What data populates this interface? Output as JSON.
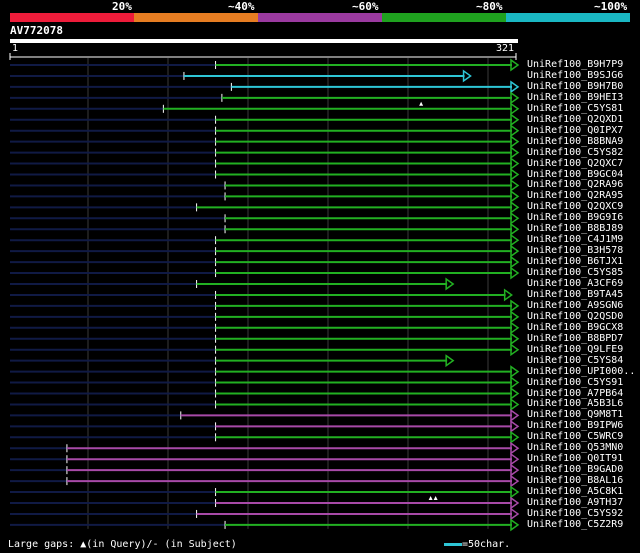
{
  "scale": {
    "labels": [
      "20%",
      "~40%",
      "~60%",
      "~80%",
      "~100%"
    ],
    "colors": [
      "#ee1c3a",
      "#e67d22",
      "#9b3aa0",
      "#1fa21f",
      "#1ab7c3"
    ]
  },
  "query": {
    "id": "AV772078",
    "start": "1",
    "end": "321",
    "length": 321
  },
  "colors": {
    "green": "#22b022",
    "cyan": "#2ec6d6",
    "purple": "#a84aa8",
    "navy": "#101a45",
    "grid": "#3a3a3a"
  },
  "hits": [
    {
      "label": "UniRef100_B9H7P9",
      "start": 131,
      "end": 321,
      "color": "green",
      "arrow": true
    },
    {
      "label": "UniRef100_B9SJG6",
      "start": 111,
      "end": 291,
      "color": "cyan",
      "arrow": true
    },
    {
      "label": "UniRef100_B9H7B0",
      "start": 141,
      "end": 321,
      "color": "cyan",
      "arrow": true
    },
    {
      "label": "UniRef100_B9HEI3",
      "start": 135,
      "end": 321,
      "color": "green",
      "arrow": true
    },
    {
      "label": "UniRef100_C5YS81",
      "start": 98,
      "end": 321,
      "color": "green",
      "arrow": true,
      "gap": 261
    },
    {
      "label": "UniRef100_Q2QXD1",
      "start": 131,
      "end": 321,
      "color": "green",
      "arrow": true
    },
    {
      "label": "UniRef100_Q0IPX7",
      "start": 131,
      "end": 321,
      "color": "green",
      "arrow": true
    },
    {
      "label": "UniRef100_B8BNA9",
      "start": 131,
      "end": 321,
      "color": "green",
      "arrow": true
    },
    {
      "label": "UniRef100_C5YS82",
      "start": 131,
      "end": 321,
      "color": "green",
      "arrow": true
    },
    {
      "label": "UniRef100_Q2QXC7",
      "start": 131,
      "end": 321,
      "color": "green",
      "arrow": true
    },
    {
      "label": "UniRef100_B9GC04",
      "start": 131,
      "end": 321,
      "color": "green",
      "arrow": true
    },
    {
      "label": "UniRef100_Q2RA96",
      "start": 137,
      "end": 321,
      "color": "green",
      "arrow": true
    },
    {
      "label": "UniRef100_Q2RA95",
      "start": 137,
      "end": 321,
      "color": "green",
      "arrow": true
    },
    {
      "label": "UniRef100_Q2QXC9",
      "start": 119,
      "end": 321,
      "color": "green",
      "arrow": true
    },
    {
      "label": "UniRef100_B9G9I6",
      "start": 137,
      "end": 321,
      "color": "green",
      "arrow": true
    },
    {
      "label": "UniRef100_B8BJ89",
      "start": 137,
      "end": 321,
      "color": "green",
      "arrow": true
    },
    {
      "label": "UniRef100_C4J1M9",
      "start": 131,
      "end": 321,
      "color": "green",
      "arrow": true
    },
    {
      "label": "UniRef100_B3H578",
      "start": 131,
      "end": 321,
      "color": "green",
      "arrow": true
    },
    {
      "label": "UniRef100_B6TJX1",
      "start": 131,
      "end": 321,
      "color": "green",
      "arrow": true
    },
    {
      "label": "UniRef100_C5YS85",
      "start": 131,
      "end": 321,
      "color": "green",
      "arrow": true
    },
    {
      "label": "UniRef100_A3CF69",
      "start": 119,
      "end": 280,
      "color": "green",
      "arrow": true
    },
    {
      "label": "UniRef100_B9TA45",
      "start": 131,
      "end": 317,
      "color": "green",
      "arrow": true
    },
    {
      "label": "UniRef100_A9SGN6",
      "start": 131,
      "end": 321,
      "color": "green",
      "arrow": true
    },
    {
      "label": "UniRef100_Q2QSD0",
      "start": 131,
      "end": 321,
      "color": "green",
      "arrow": true
    },
    {
      "label": "UniRef100_B9GCX8",
      "start": 131,
      "end": 321,
      "color": "green",
      "arrow": true
    },
    {
      "label": "UniRef100_B8BPD7",
      "start": 131,
      "end": 321,
      "color": "green",
      "arrow": true
    },
    {
      "label": "UniRef100_Q9LFE9",
      "start": 131,
      "end": 321,
      "color": "green",
      "arrow": true
    },
    {
      "label": "UniRef100_C5YS84",
      "start": 131,
      "end": 280,
      "color": "green",
      "arrow": true
    },
    {
      "label": "UniRef100_UPI000..",
      "start": 131,
      "end": 321,
      "color": "green",
      "arrow": true
    },
    {
      "label": "UniRef100_C5YS91",
      "start": 131,
      "end": 321,
      "color": "green",
      "arrow": true
    },
    {
      "label": "UniRef100_A7PB64",
      "start": 131,
      "end": 321,
      "color": "green",
      "arrow": true
    },
    {
      "label": "UniRef100_A5B3L6",
      "start": 131,
      "end": 321,
      "color": "green",
      "arrow": true
    },
    {
      "label": "UniRef100_Q9M8T1",
      "start": 109,
      "end": 321,
      "color": "purple",
      "arrow": true
    },
    {
      "label": "UniRef100_B9IPW6",
      "start": 131,
      "end": 321,
      "color": "purple",
      "arrow": true
    },
    {
      "label": "UniRef100_C5WRC9",
      "start": 131,
      "end": 321,
      "color": "green",
      "arrow": true
    },
    {
      "label": "UniRef100_Q53MN0",
      "start": 37,
      "end": 321,
      "color": "purple",
      "arrow": true
    },
    {
      "label": "UniRef100_Q0IT91",
      "start": 37,
      "end": 321,
      "color": "purple",
      "arrow": true
    },
    {
      "label": "UniRef100_B9GAD0",
      "start": 37,
      "end": 321,
      "color": "purple",
      "arrow": true
    },
    {
      "label": "UniRef100_B8AL16",
      "start": 37,
      "end": 321,
      "color": "purple",
      "arrow": true
    },
    {
      "label": "UniRef100_A5C8K1",
      "start": 131,
      "end": 321,
      "color": "green",
      "arrow": true
    },
    {
      "label": "UniRef100_A9TH37",
      "start": 131,
      "end": 321,
      "color": "purple",
      "arrow": true,
      "gap": 267
    },
    {
      "label": "UniRef100_C5YS92",
      "start": 119,
      "end": 321,
      "color": "purple",
      "arrow": true
    },
    {
      "label": "UniRef100_C5Z2R9",
      "start": 137,
      "end": 321,
      "color": "green",
      "arrow": true
    }
  ],
  "footer": {
    "gaps_prefix": "Large gaps: ",
    "gaps_marker": "▲",
    "gaps_text": "(in Query)/- (in Subject)",
    "legend_text": "=50char."
  }
}
